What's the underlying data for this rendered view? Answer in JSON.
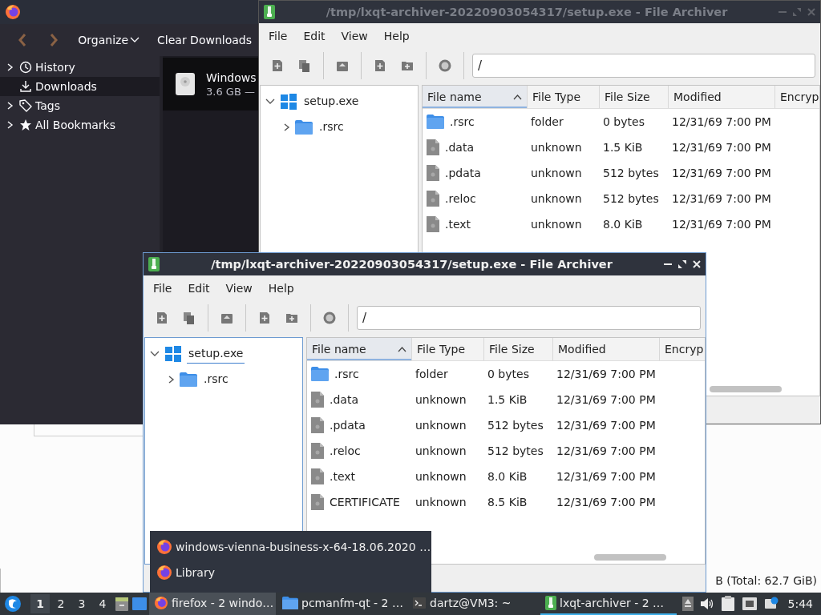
{
  "file_manager": {
    "status": "B (Total: 62.7 GiB)"
  },
  "library": {
    "toolbar": {
      "organize": "Organize",
      "clear": "Clear Downloads"
    },
    "sidebar": [
      {
        "label": "History",
        "kind": "history",
        "expandable": true,
        "selected": false
      },
      {
        "label": "Downloads",
        "kind": "downloads",
        "expandable": false,
        "selected": true
      },
      {
        "label": "Tags",
        "kind": "tags",
        "expandable": true,
        "selected": false
      },
      {
        "label": "All Bookmarks",
        "kind": "bookmarks",
        "expandable": true,
        "selected": false
      }
    ],
    "download": {
      "name": "Windows",
      "size": "3.6 GB —"
    }
  },
  "archivers": [
    {
      "title": "/tmp/lxqt-archiver-20220903054317/setup.exe - File Archiver",
      "active": false,
      "menu": [
        "File",
        "Edit",
        "View",
        "Help"
      ],
      "path": "/",
      "tree": {
        "label": "setup.exe",
        "kind": "exe",
        "expanded": true,
        "focused": false,
        "children": [
          {
            "label": ".rsrc",
            "kind": "folder",
            "expanded": false
          }
        ]
      },
      "columns": [
        {
          "label": "File name",
          "sorted": true
        },
        {
          "label": "File Type",
          "sorted": false
        },
        {
          "label": "File Size",
          "sorted": false
        },
        {
          "label": "Modified",
          "sorted": false
        },
        {
          "label": "Encryp",
          "sorted": false
        }
      ],
      "rows": [
        {
          "name": ".rsrc",
          "kind": "folder",
          "type": "folder",
          "size": "0 bytes",
          "modified": "12/31/69 7:00 PM"
        },
        {
          "name": ".data",
          "kind": "file",
          "type": "unknown",
          "size": "1.5 KiB",
          "modified": "12/31/69 7:00 PM"
        },
        {
          "name": ".pdata",
          "kind": "file",
          "type": "unknown",
          "size": "512 bytes",
          "modified": "12/31/69 7:00 PM"
        },
        {
          "name": ".reloc",
          "kind": "file",
          "type": "unknown",
          "size": "512 bytes",
          "modified": "12/31/69 7:00 PM"
        },
        {
          "name": ".text",
          "kind": "file",
          "type": "unknown",
          "size": "8.0 KiB",
          "modified": "12/31/69 7:00 PM"
        }
      ]
    },
    {
      "title": "/tmp/lxqt-archiver-20220903054317/setup.exe - File Archiver",
      "active": true,
      "menu": [
        "File",
        "Edit",
        "View",
        "Help"
      ],
      "path": "/",
      "tree": {
        "label": "setup.exe",
        "kind": "exe",
        "expanded": true,
        "focused": true,
        "children": [
          {
            "label": ".rsrc",
            "kind": "folder",
            "expanded": false
          }
        ]
      },
      "columns": [
        {
          "label": "File name",
          "sorted": true
        },
        {
          "label": "File Type",
          "sorted": false
        },
        {
          "label": "File Size",
          "sorted": false
        },
        {
          "label": "Modified",
          "sorted": false
        },
        {
          "label": "Encryp",
          "sorted": false
        }
      ],
      "rows": [
        {
          "name": ".rsrc",
          "kind": "folder",
          "type": "folder",
          "size": "0 bytes",
          "modified": "12/31/69 7:00 PM"
        },
        {
          "name": ".data",
          "kind": "file",
          "type": "unknown",
          "size": "1.5 KiB",
          "modified": "12/31/69 7:00 PM"
        },
        {
          "name": ".pdata",
          "kind": "file",
          "type": "unknown",
          "size": "512 bytes",
          "modified": "12/31/69 7:00 PM"
        },
        {
          "name": ".reloc",
          "kind": "file",
          "type": "unknown",
          "size": "512 bytes",
          "modified": "12/31/69 7:00 PM"
        },
        {
          "name": ".text",
          "kind": "file",
          "type": "unknown",
          "size": "8.0 KiB",
          "modified": "12/31/69 7:00 PM"
        },
        {
          "name": "CERTIFICATE",
          "kind": "file",
          "type": "unknown",
          "size": "8.5 KiB",
          "modified": "12/31/69 7:00 PM"
        }
      ]
    }
  ],
  "popup_menu": [
    {
      "label": "windows-vienna-business-x-64-18.06.2020 …"
    },
    {
      "label": "Library"
    }
  ],
  "taskbar": {
    "workspaces": [
      {
        "label": "1",
        "selected": true
      },
      {
        "label": "2",
        "selected": false
      },
      {
        "label": "3",
        "selected": false
      },
      {
        "label": "4",
        "selected": false
      }
    ],
    "tasks": [
      {
        "label": "firefox - 2 windo…",
        "kind": "firefox",
        "highlighted": true,
        "active": false
      },
      {
        "label": "pcmanfm-qt - 2 …",
        "kind": "folder",
        "highlighted": false,
        "active": false
      },
      {
        "label": "dartz@VM3: ~",
        "kind": "terminal",
        "highlighted": false,
        "active": false
      },
      {
        "label": "lxqt-archiver - 2 …",
        "kind": "archiver",
        "highlighted": false,
        "active": true
      }
    ],
    "clock": "5:44"
  }
}
